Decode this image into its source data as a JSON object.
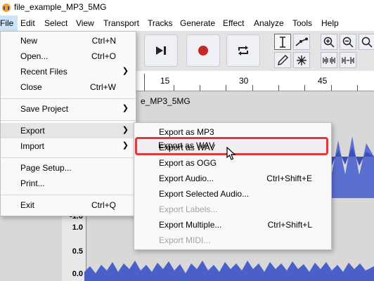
{
  "window": {
    "title": "file_example_MP3_5MG"
  },
  "menubar": [
    "File",
    "Edit",
    "Select",
    "View",
    "Transport",
    "Tracks",
    "Generate",
    "Effect",
    "Analyze",
    "Tools",
    "Help"
  ],
  "ruler": {
    "labels": [
      "15",
      "30",
      "45"
    ]
  },
  "track": {
    "clip_name": "e_MP3_5MG",
    "scale_labels": [
      "-1.0",
      "1.0",
      "0.5",
      "0.0"
    ]
  },
  "file_menu": {
    "items": [
      {
        "label": "New",
        "shortcut": "Ctrl+N"
      },
      {
        "label": "Open...",
        "shortcut": "Ctrl+O"
      },
      {
        "label": "Recent Files",
        "submenu": true
      },
      {
        "label": "Close",
        "shortcut": "Ctrl+W"
      },
      {
        "label": "Save Project",
        "submenu": true
      },
      {
        "label": "Export",
        "submenu": true,
        "highlighted": true
      },
      {
        "label": "Import",
        "submenu": true
      },
      {
        "label": "Page Setup..."
      },
      {
        "label": "Print..."
      },
      {
        "label": "Exit",
        "shortcut": "Ctrl+Q"
      }
    ]
  },
  "export_menu": {
    "items": [
      {
        "label": "Export as MP3"
      },
      {
        "label": "Export as WAV",
        "highlighted": true
      },
      {
        "label": "Export as OGG"
      },
      {
        "label": "Export Audio...",
        "shortcut": "Ctrl+Shift+E"
      },
      {
        "label": "Export Selected Audio..."
      },
      {
        "label": "Export Labels...",
        "disabled": true
      },
      {
        "label": "Export Multiple...",
        "shortcut": "Ctrl+Shift+L"
      },
      {
        "label": "Export MIDI...",
        "disabled": true
      }
    ]
  },
  "colors": {
    "highlight_box": "#dd3b3b",
    "waveform": "#4a5fc8",
    "menu_selected": "#cce4f7"
  }
}
